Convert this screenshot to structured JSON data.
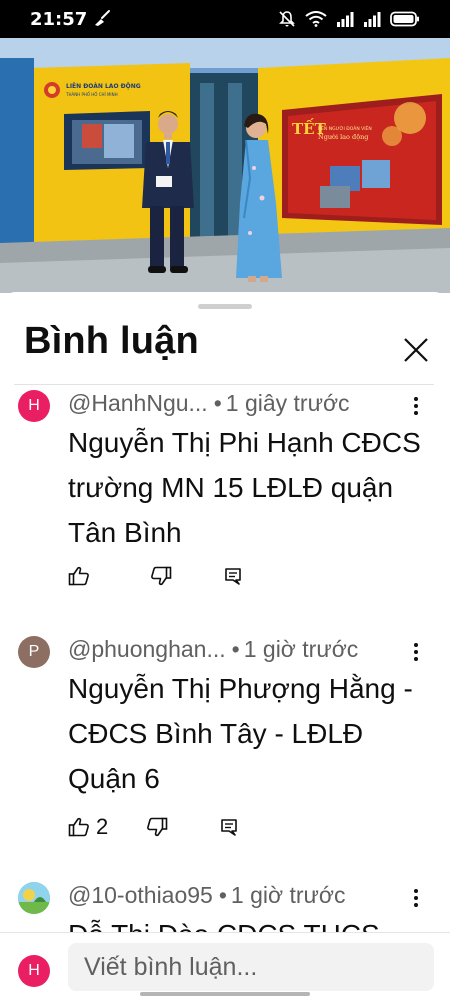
{
  "status_bar": {
    "time": "21:57",
    "icons": [
      "broom-icon",
      "mute-bell-icon",
      "wifi-icon",
      "signal-icon",
      "signal-icon-2",
      "battery-icon"
    ]
  },
  "video": {
    "logo_line1": "LIÊN ĐOÀN LAO ĐỘNG",
    "logo_line2": "THÀNH PHỐ HỒ CHÍ MINH",
    "screen_title": "TẾT",
    "screen_subtitle": "BÊN NGƯỜI ĐOÀN VIÊN",
    "screen_subtitle2": "Người lao động"
  },
  "comments_sheet": {
    "title": "Bình luận",
    "close_icon": "close-icon",
    "comments": [
      {
        "avatar_letter": "H",
        "avatar_color": "#e91e63",
        "author": "@HanhNgu...",
        "time": "1 giây trước",
        "text": "Nguyễn Thị Phi Hạnh CĐCS trường MN 15 LĐLĐ quận Tân Bình",
        "likes": ""
      },
      {
        "avatar_letter": "P",
        "avatar_color": "#8d6e63",
        "author": "@phuonghan...",
        "time": "1 giờ trước",
        "text": "Nguyễn Thị Phượng Hằng - CĐCS Bình Tây - LĐLĐ Quận 6",
        "likes": "2"
      },
      {
        "avatar_letter": "",
        "avatar_color": "#7ec8e3",
        "author": "@10-othiao95",
        "time": "1 giờ trước",
        "text": "Đỗ Thị Đào CĐCS THCS",
        "likes": ""
      }
    ]
  },
  "input": {
    "avatar_letter": "H",
    "placeholder": "Viết bình luận..."
  }
}
